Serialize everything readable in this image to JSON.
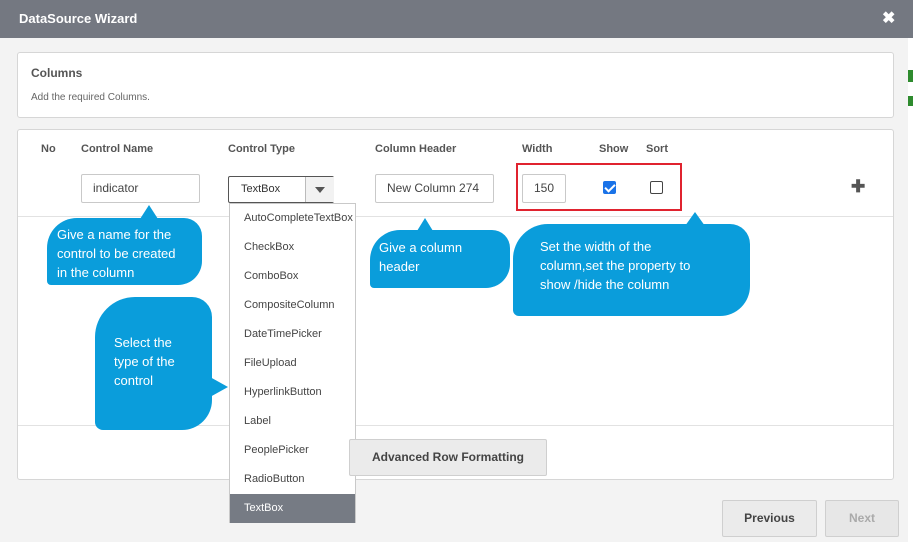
{
  "dialog": {
    "title": "DataSource Wizard",
    "close_icon": "close-icon"
  },
  "columns_panel": {
    "title": "Columns",
    "subtitle": "Add the required Columns."
  },
  "grid": {
    "headers": {
      "no": "No",
      "control_name": "Control Name",
      "control_type": "Control Type",
      "column_header": "Column Header",
      "width": "Width",
      "show": "Show",
      "sort": "Sort"
    },
    "row": {
      "control_name": "indicator",
      "control_type": "TextBox",
      "column_header": "New Column 274",
      "width": "150",
      "show": true,
      "sort": false
    }
  },
  "control_type_options": [
    "AutoCompleteTextBox",
    "CheckBox",
    "ComboBox",
    "CompositeColumn",
    "DateTimePicker",
    "FileUpload",
    "HyperlinkButton",
    "Label",
    "PeoplePicker",
    "RadioButton",
    "TextBox"
  ],
  "callouts": {
    "control_name": [
      "Give a name for the",
      "control to be created",
      "in the column"
    ],
    "column_header": [
      "Give a column",
      "header"
    ],
    "width_show": [
      "Set the width of the",
      "column,set the property to",
      "show /hide the column"
    ],
    "control_type": [
      "Select the",
      "type of the",
      "control"
    ]
  },
  "buttons": {
    "advanced": "Advanced Row Formatting",
    "previous": "Previous",
    "next": "Next"
  },
  "colors": {
    "titlebar": "#747881",
    "callout": "#0a9ddb",
    "highlight": "#e0232f",
    "selected_option": "#767b84"
  }
}
